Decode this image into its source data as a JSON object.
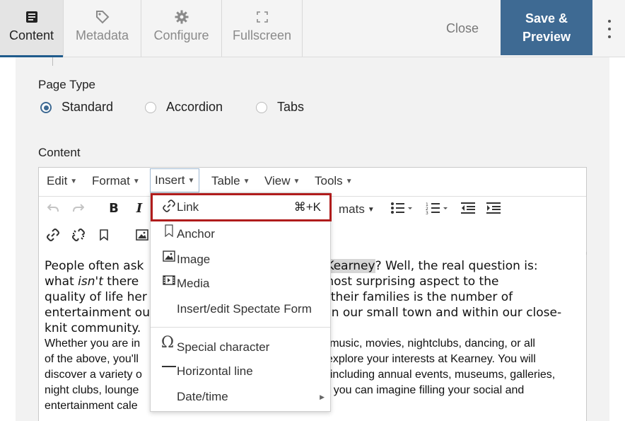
{
  "topbar": {
    "tabs": [
      {
        "label": "Content",
        "icon": "content-icon",
        "active": true
      },
      {
        "label": "Metadata",
        "icon": "tag-icon"
      },
      {
        "label": "Configure",
        "icon": "gear-icon"
      },
      {
        "label": "Fullscreen",
        "icon": "fullscreen-icon"
      }
    ],
    "close_label": "Close",
    "save_label": "Save &\nPreview",
    "accent_color": "#3e6a93"
  },
  "form": {
    "page_type_label": "Page Type",
    "page_type_options": [
      {
        "label": "Standard",
        "checked": true
      },
      {
        "label": "Accordion",
        "checked": false
      },
      {
        "label": "Tabs",
        "checked": false
      }
    ],
    "content_label": "Content"
  },
  "editor": {
    "menus": [
      "Edit",
      "Format",
      "Insert",
      "Table",
      "View",
      "Tools"
    ],
    "open_menu": "Insert",
    "formats_partial": "mats",
    "body": {
      "p1_a": "People often ask",
      "p1_b": "Kearney",
      "p1_c": "? Well, the real question is:",
      "p2_a": "what",
      "p2_em": "isn't",
      "p2_b": "there",
      "p2_c": "the most surprising aspect to the",
      "p3_a": "quality of life her",
      "p3_b": "their families is the number of",
      "p4_a": "entertainment ou",
      "p4_b": "in our small town and within our close-",
      "p5": "knit community.",
      "s1_a": "Whether you are in",
      "s1_b": "music, movies, nightclubs, dancing, or all",
      "s2_a": "of the above, you'll",
      "s2_b": "explore your interests at Kearney. You will",
      "s3_a": "discover a variety o",
      "s3_b": "including annual events, museums, galleries,",
      "s4_a": "night clubs, lounge",
      "s4_b": "e you can imagine filling your social and",
      "s5": "entertainment cale"
    }
  },
  "insert_menu": {
    "items": [
      {
        "label": "Link",
        "icon": "link-icon",
        "shortcut": "⌘+K",
        "highlighted": true
      },
      {
        "label": "Anchor",
        "icon": "bookmark-icon"
      },
      {
        "label": "Image",
        "icon": "image-icon"
      },
      {
        "label": "Media",
        "icon": "media-icon"
      },
      {
        "label": "Insert/edit Spectate Form",
        "icon": ""
      },
      {
        "label": "Special character",
        "icon": "omega-icon"
      },
      {
        "label": "Horizontal line",
        "icon": "horizontal-line-icon"
      },
      {
        "label": "Date/time",
        "icon": "",
        "submenu": true
      }
    ],
    "highlight_color": "#b01c1c"
  }
}
